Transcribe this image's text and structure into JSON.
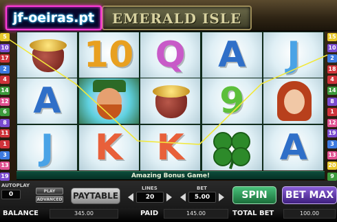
{
  "watermark": {
    "text": "jf-oeiras.pt"
  },
  "header": {
    "title": "EMERALD ISLE"
  },
  "paylines": {
    "left": [
      {
        "num": "5",
        "color": "#e8c82c"
      },
      {
        "num": "10",
        "color": "#7a4bd0"
      },
      {
        "num": "17",
        "color": "#d0333a"
      },
      {
        "num": "2",
        "color": "#3c7ae0"
      },
      {
        "num": "4",
        "color": "#d0333a"
      },
      {
        "num": "14",
        "color": "#3c9a3c"
      },
      {
        "num": "12",
        "color": "#e05090"
      },
      {
        "num": "6",
        "color": "#3c9a3c"
      },
      {
        "num": "8",
        "color": "#7a4bd0"
      },
      {
        "num": "11",
        "color": "#d0333a"
      },
      {
        "num": "1",
        "color": "#d0333a"
      },
      {
        "num": "3",
        "color": "#3c7ae0"
      },
      {
        "num": "13",
        "color": "#e05090"
      },
      {
        "num": "19",
        "color": "#7a4bd0"
      }
    ],
    "right": [
      {
        "num": "15",
        "color": "#e8c82c"
      },
      {
        "num": "10",
        "color": "#7a4bd0"
      },
      {
        "num": "2",
        "color": "#3c7ae0"
      },
      {
        "num": "18",
        "color": "#d0333a"
      },
      {
        "num": "4",
        "color": "#d0333a"
      },
      {
        "num": "14",
        "color": "#3c9a3c"
      },
      {
        "num": "8",
        "color": "#7a4bd0"
      },
      {
        "num": "1",
        "color": "#d0333a"
      },
      {
        "num": "12",
        "color": "#e05090"
      },
      {
        "num": "19",
        "color": "#7a4bd0"
      },
      {
        "num": "3",
        "color": "#3c7ae0"
      },
      {
        "num": "13",
        "color": "#e05090"
      },
      {
        "num": "20",
        "color": "#e8c82c"
      },
      {
        "num": "9",
        "color": "#3c9a3c"
      }
    ]
  },
  "reels": [
    [
      {
        "symbol": "pot",
        "text": ""
      },
      {
        "symbol": "A",
        "text": "A",
        "color": "#2f6fc8"
      },
      {
        "symbol": "J",
        "text": "J",
        "color": "#4aa3e6"
      }
    ],
    [
      {
        "symbol": "10",
        "text": "10",
        "color": "#e8a020"
      },
      {
        "symbol": "leprechaun",
        "text": ""
      },
      {
        "symbol": "K",
        "text": "K",
        "color": "#e8603a"
      }
    ],
    [
      {
        "symbol": "Q",
        "text": "Q",
        "color": "#c85ac8"
      },
      {
        "symbol": "pot",
        "text": ""
      },
      {
        "symbol": "K",
        "text": "K",
        "color": "#e8603a"
      }
    ],
    [
      {
        "symbol": "A",
        "text": "A",
        "color": "#2f6fc8"
      },
      {
        "symbol": "9",
        "text": "9",
        "color": "#5cbf3a"
      },
      {
        "symbol": "clover",
        "text": ""
      }
    ],
    [
      {
        "symbol": "J",
        "text": "J",
        "color": "#4aa3e6"
      },
      {
        "symbol": "woman",
        "text": ""
      },
      {
        "symbol": "A",
        "text": "A",
        "color": "#2f6fc8"
      }
    ]
  ],
  "message": "Amazing Bonus Game!",
  "controls": {
    "autoplay_label": "AUTOPLAY",
    "autoplay_value": "0",
    "play_label": "PLAY",
    "advanced_label": "ADVANCED",
    "paytable_label": "PAYTABLE",
    "lines_label": "LINES",
    "lines_value": "20",
    "bet_label": "BET",
    "bet_value": "5.00",
    "spin_label": "SPIN",
    "betmax_label": "BET MAX"
  },
  "status": {
    "balance_label": "BALANCE",
    "balance_value": "345.00",
    "paid_label": "PAID",
    "paid_value": "145.00",
    "total_bet_label": "TOTAL BET",
    "total_bet_value": "100.00"
  }
}
